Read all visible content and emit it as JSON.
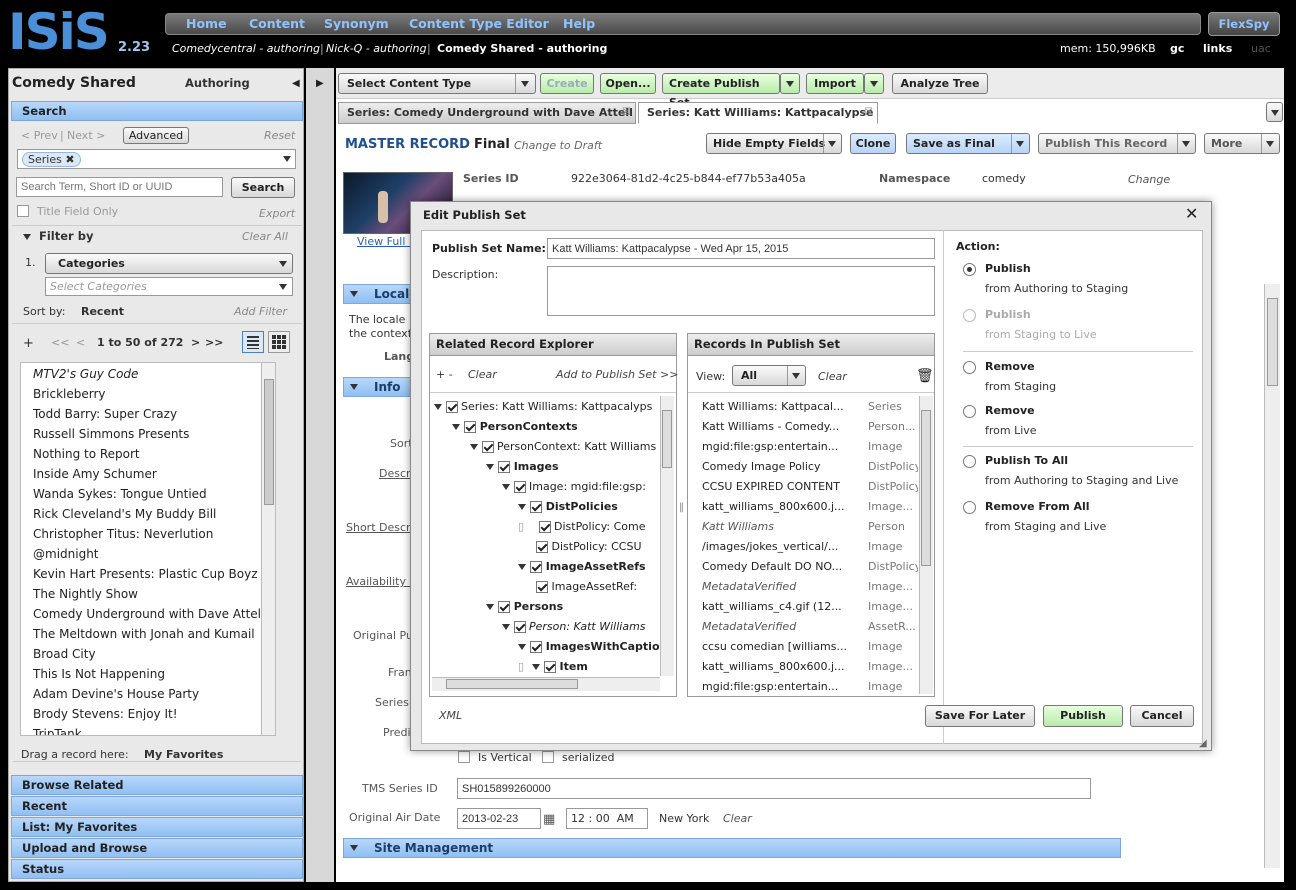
{
  "app": {
    "logo": "ISiS",
    "version": "2.23"
  },
  "nav": {
    "items": [
      "Home",
      "Content",
      "Synonym",
      "Content Type Editor",
      "Help"
    ],
    "flexspy": "FlexSpy"
  },
  "env": {
    "link1": "Comedycentral - authoring",
    "link2": "Nick-Q - authoring",
    "link3": "Comedy Shared - authoring",
    "mem": "mem: 150,996KB",
    "gc": "gc",
    "links": "links",
    "uac": "uac"
  },
  "left": {
    "title": "Comedy Shared",
    "mode": "Authoring",
    "search_hdr": "Search",
    "prev": "< Prev",
    "next": "Next >",
    "advanced": "Advanced",
    "reset": "Reset",
    "series_chip": "Series",
    "search_placeholder": "Search Term, Short ID or UUID",
    "search_btn": "Search",
    "title_only": "Title Field Only",
    "export": "Export",
    "filter_by": "Filter by",
    "clear_all": "Clear All",
    "filter_num": "1.",
    "categories": "Categories",
    "select_categories": "Select Categories",
    "sort_label": "Sort by:",
    "sort_value": "Recent",
    "add_filter": "Add Filter",
    "plus": "+",
    "pager_first": "<<",
    "pager_prev": "<",
    "pager_range": "1 to 50 of 272",
    "pager_next": ">",
    "pager_last": ">>",
    "items": [
      "MTV2's Guy Code",
      "Brickleberry",
      "Todd Barry: Super Crazy",
      "Russell Simmons Presents",
      "Nothing to Report",
      "Inside Amy Schumer",
      "Wanda Sykes: Tongue Untied",
      "Rick Cleveland's My Buddy Bill",
      "Christopher Titus: Neverlution",
      "@midnight",
      "Kevin Hart Presents: Plastic Cup Boyz",
      "The Nightly Show",
      "Comedy Underground with Dave Attell",
      "The Meltdown with Jonah and Kumail",
      "Broad City",
      "This Is Not Happening",
      "Adam Devine's House Party",
      "Brody Stevens: Enjoy It!",
      "TripTank"
    ],
    "drag_label": "Drag a record here:",
    "favorites": "My Favorites",
    "bottom_sections": [
      "Browse Related",
      "Recent",
      "List: My Favorites",
      "Upload and Browse",
      "Status"
    ]
  },
  "toolbar": {
    "select_type": "Select Content Type",
    "create": "Create",
    "open": "Open...",
    "create_publish_set": "Create Publish Set",
    "import": "Import",
    "analyze": "Analyze Tree"
  },
  "tabs": [
    "Series: Comedy Underground with Dave Attell",
    "Series: Katt Williams: Kattpacalypse"
  ],
  "record": {
    "master": "MASTER RECORD",
    "status": "Final",
    "change_draft": "Change to Draft",
    "hide_empty": "Hide Empty Fields",
    "clone": "Clone",
    "save_final": "Save as Final",
    "publish_record": "Publish This Record",
    "more": "More",
    "series_id_lbl": "Series ID",
    "series_id": "922e3064-81d2-4c25-b844-ef77b53a405a",
    "namespace_lbl": "Namespace",
    "namespace": "comedy",
    "change": "Change",
    "view_full": "View Full I",
    "locale": "Locale",
    "locale_text1": "The locale",
    "locale_text2": "the context",
    "lang": "Lang",
    "info": "Info",
    "sort": "Sort",
    "descr": "Descri",
    "short_descr": "Short Descri",
    "availability": "Availability I",
    "original_pu": "Original Pu",
    "fran": "Fran",
    "series": "Series",
    "predi": "Predi",
    "is_vertical": "Is Vertical",
    "serialized": "serialized",
    "tms_lbl": "TMS Series ID",
    "tms": "SH015899260000",
    "air_lbl": "Original Air Date",
    "air_date": "2013-02-23",
    "air_h": "12",
    "air_m": "00",
    "air_ampm": "AM",
    "tz": "New York",
    "clear": "Clear",
    "site_mgmt": "Site Management"
  },
  "modal": {
    "title": "Edit Publish Set",
    "name_lbl": "Publish Set Name:",
    "name_val": "Katt Williams: Kattpacalypse - Wed Apr 15, 2015",
    "desc_lbl": "Description:",
    "explorer_hdr": "Related Record Explorer",
    "plusminus": "+ -",
    "clear": "Clear",
    "add_to": "Add to Publish Set >>",
    "tree": [
      {
        "t": "Series: Katt Williams: Kattpacalyps",
        "b": false,
        "i": false
      },
      {
        "t": "PersonContexts",
        "b": true,
        "i": false
      },
      {
        "t": "PersonContext: Katt Williams",
        "b": false,
        "i": false
      },
      {
        "t": "Images",
        "b": true,
        "i": false
      },
      {
        "t": "Image: mgid:file:gsp:",
        "b": false,
        "i": false
      },
      {
        "t": "DistPolicies",
        "b": true,
        "i": false
      },
      {
        "t": "DistPolicy: Come",
        "b": false,
        "i": false
      },
      {
        "t": "DistPolicy: CCSU",
        "b": false,
        "i": false
      },
      {
        "t": "ImageAssetRefs",
        "b": true,
        "i": false
      },
      {
        "t": "ImageAssetRef:",
        "b": false,
        "i": false
      },
      {
        "t": "Persons",
        "b": true,
        "i": false
      },
      {
        "t": "Person: Katt Williams",
        "b": false,
        "i": true
      },
      {
        "t": "ImagesWithCaption",
        "b": true,
        "i": false
      },
      {
        "t": "Item",
        "b": true,
        "i": false
      }
    ],
    "records_hdr": "Records In Publish Set",
    "view_lbl": "View:",
    "view_val": "All",
    "records": [
      {
        "n": "Katt Williams: Kattpacal...",
        "t": "Series",
        "i": false
      },
      {
        "n": "Katt Williams - Comedy...",
        "t": "Person...",
        "i": false
      },
      {
        "n": "mgid:file:gsp:entertain...",
        "t": "Image",
        "i": false
      },
      {
        "n": "Comedy Image Policy",
        "t": "DistPolicy",
        "i": false
      },
      {
        "n": "CCSU EXPIRED CONTENT",
        "t": "DistPolicy",
        "i": false
      },
      {
        "n": "katt_williams_800x600.j...",
        "t": "Image...",
        "i": false
      },
      {
        "n": "Katt Williams",
        "t": "Person",
        "i": true
      },
      {
        "n": "/images/jokes_vertical/...",
        "t": "Image",
        "i": false
      },
      {
        "n": "Comedy Default DO NO...",
        "t": "DistPolicy",
        "i": false
      },
      {
        "n": "MetadataVerified",
        "t": "Image...",
        "i": true
      },
      {
        "n": "katt_williams_c4.gif (12...",
        "t": "Image...",
        "i": false
      },
      {
        "n": "MetadataVerified",
        "t": "AssetR...",
        "i": true
      },
      {
        "n": "ccsu comedian [williams...",
        "t": "Image",
        "i": false
      },
      {
        "n": "katt_williams_800x600.j...",
        "t": "Image...",
        "i": false
      },
      {
        "n": "mgid:file:gsp:entertain...",
        "t": "Image",
        "i": false
      }
    ],
    "action_lbl": "Action:",
    "actions": [
      {
        "a": "Publish",
        "s": "from Authoring to Staging",
        "on": true,
        "dis": false
      },
      {
        "a": "Publish",
        "s": "from Staging to Live",
        "on": false,
        "dis": true
      },
      {
        "a": "Remove",
        "s": "from Staging",
        "on": false,
        "dis": false
      },
      {
        "a": "Remove",
        "s": "from Live",
        "on": false,
        "dis": false
      },
      {
        "a": "Publish To All",
        "s": "from Authoring to Staging and Live",
        "on": false,
        "dis": false
      },
      {
        "a": "Remove From All",
        "s": "from Staging and Live",
        "on": false,
        "dis": false
      }
    ],
    "xml": "XML",
    "save_later": "Save For Later",
    "publish": "Publish",
    "cancel": "Cancel"
  }
}
